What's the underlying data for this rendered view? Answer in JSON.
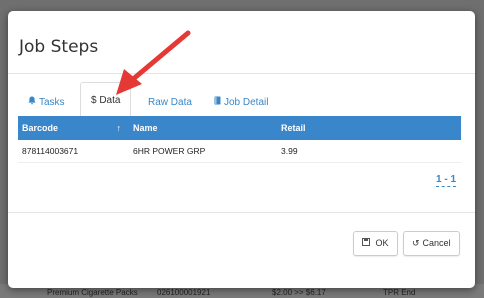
{
  "modal": {
    "title": "Job Steps",
    "tabs": [
      {
        "label": "Tasks",
        "icon": "bell-icon",
        "glyph": "🔔"
      },
      {
        "label": "$ Data",
        "icon": "dollar-icon",
        "glyph": ""
      },
      {
        "label": "Raw Data",
        "icon": "",
        "glyph": ""
      },
      {
        "label": "Job Detail",
        "icon": "book-icon",
        "glyph": "▮"
      }
    ],
    "active_tab": "$ Data",
    "table": {
      "columns": [
        "Barcode",
        "Name",
        "Retail"
      ],
      "sort_indicator": "↑",
      "rows": [
        [
          "878114003671",
          "6HR POWER GRP",
          "3.99"
        ]
      ]
    },
    "pager": "1 - 1",
    "buttons": {
      "ok_label": "OK",
      "ok_glyph": "🖫",
      "cancel_label": "Cancel",
      "cancel_glyph": "↺"
    }
  },
  "background": {
    "row_text": [
      "Premium Cigarette Packs",
      "026100001921",
      "$2.00 >> $6.17",
      "TPR End"
    ]
  },
  "colors": {
    "accent": "#3a87c7",
    "table_header": "#3a86cb",
    "annotation_arrow": "#e53935"
  }
}
